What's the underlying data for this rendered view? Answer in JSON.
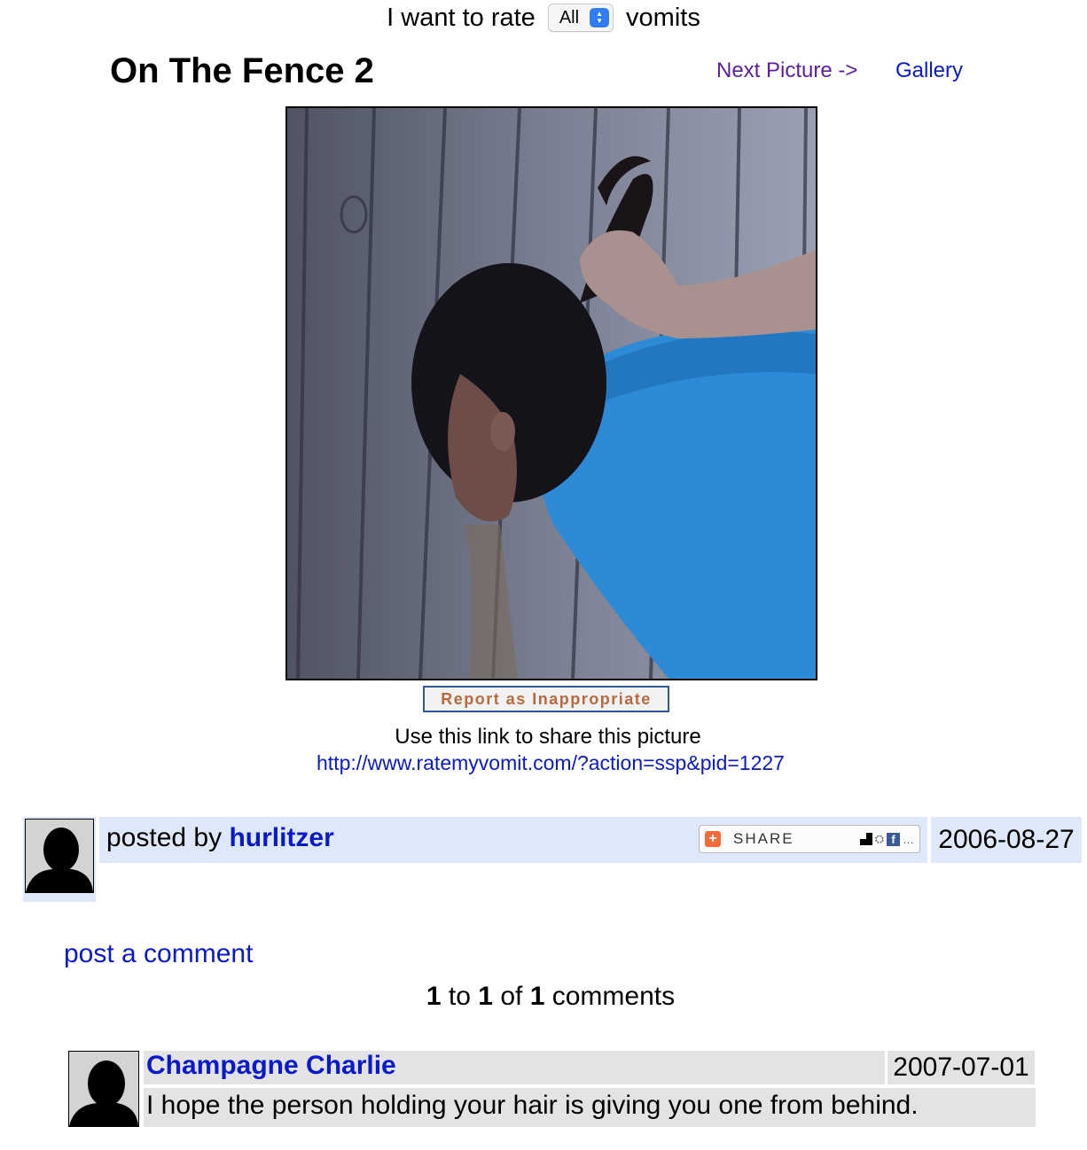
{
  "rate_bar": {
    "prefix": "I want to rate",
    "select_value": "All",
    "suffix": "vomits"
  },
  "picture": {
    "title": "On The Fence 2",
    "next_label": "Next Picture ->",
    "gallery_label": "Gallery"
  },
  "report_button": "Report as Inappropriate",
  "share": {
    "caption": "Use this link to share this picture",
    "url": "http://www.ratemyvomit.com/?action=ssp&pid=1227"
  },
  "post": {
    "posted_by_label": "posted by",
    "author": "hurlitzer",
    "share_widget_label": "SHARE",
    "date": "2006-08-27"
  },
  "post_comment_label": "post a comment",
  "comments_summary": {
    "from": "1",
    "to_label": "to",
    "to": "1",
    "of_label": "of",
    "total": "1",
    "suffix": "comments"
  },
  "comments": [
    {
      "author": "Champagne Charlie",
      "date": "2007-07-01",
      "text": "I hope the person holding your hair is giving you one from behind."
    }
  ],
  "colors": {
    "link": "#0a1acb",
    "visited_link": "#5b1f9e",
    "post_bar": "#dde8f8",
    "comment_bar": "#e3e3e3",
    "report_text": "#b86a3e"
  }
}
